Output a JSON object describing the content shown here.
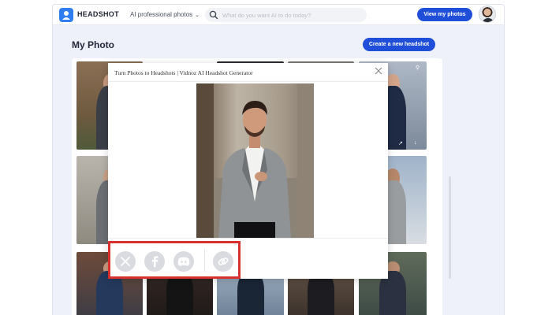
{
  "header": {
    "brand": "HEADSHOT",
    "menu_label": "AI professional photos",
    "search_placeholder": "What do you want AI to do today?",
    "view_button": "View my photos"
  },
  "page": {
    "title": "My Photo",
    "create_button": "Create a new headshot"
  },
  "modal": {
    "title": "Turn Photos to Headshots | Vidnoz AI Headshot Generator",
    "share_icons": [
      "x-icon",
      "facebook-icon",
      "discord-icon",
      "link-icon"
    ]
  },
  "colors": {
    "accent": "#1f4fd8",
    "logo": "#2f7df0",
    "highlight": "#d9302e"
  }
}
